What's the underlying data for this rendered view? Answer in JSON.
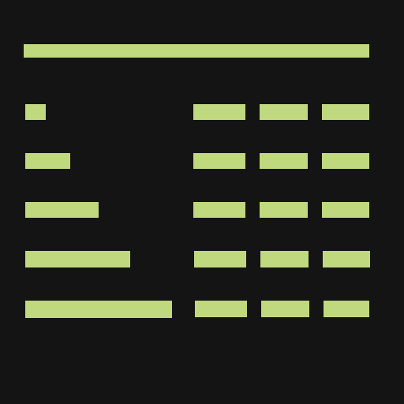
{
  "theme": {
    "background": "#141414",
    "accent": "#c0d97e"
  },
  "header": {
    "label": ""
  },
  "rows": [
    {
      "label": "",
      "cells": [
        "",
        "",
        ""
      ]
    },
    {
      "label": "",
      "cells": [
        "",
        "",
        ""
      ]
    },
    {
      "label": "",
      "cells": [
        "",
        "",
        ""
      ]
    },
    {
      "label": "",
      "cells": [
        "",
        "",
        ""
      ]
    },
    {
      "label": "",
      "cells": [
        "",
        "",
        ""
      ]
    }
  ]
}
